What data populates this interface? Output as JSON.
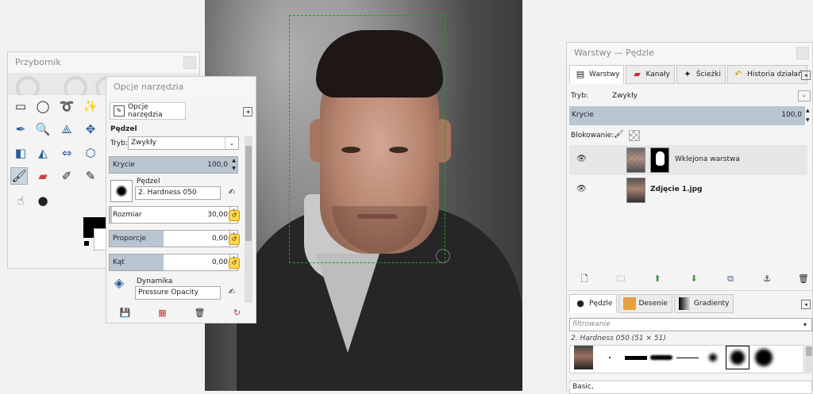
{
  "toolbox": {
    "title": "Przybornik",
    "tools": [
      "rect-select-icon",
      "ellipse-select-icon",
      "lasso-icon",
      "fuzzy-select-icon",
      "color-picker-icon",
      "zoom-icon",
      "measure-icon",
      "move-icon",
      "align-icon",
      "crop-icon",
      "transform-icon",
      "cage-icon",
      "paintbrush-icon",
      "eraser-icon",
      "airbrush-icon",
      "ink-icon",
      "smudge-icon",
      "dodge-burn-icon"
    ]
  },
  "tool_options": {
    "title": "Opcje narzędzia",
    "tab_label": "Opcje narzędzia",
    "heading": "Pędzel",
    "mode_label": "Tryb:",
    "mode_value": "Zwykły",
    "opacity_label": "Krycie",
    "opacity_value": "100,0",
    "opacity_fraction": 1.0,
    "brush_label": "Pędzel",
    "brush_value": "2. Hardness 050",
    "size_label": "Rozmiar",
    "size_value": "30,00",
    "aspect_label": "Proporcje",
    "aspect_value": "0,00",
    "angle_label": "Kąt",
    "angle_value": "0,00",
    "dynamics_label": "Dynamika",
    "dynamics_value": "Pressure Opacity"
  },
  "layers_dock": {
    "title": "Warstwy — Pędzle",
    "tabs": [
      "Warstwy",
      "Kanały",
      "Ścieżki",
      "Historia działań"
    ],
    "mode_label": "Tryb:",
    "mode_value": "Zwykły",
    "opacity_label": "Krycie",
    "opacity_value": "100,0",
    "lock_label": "Blokowanie:",
    "layers": [
      {
        "name": "Wklejona warstwa",
        "selected": true
      },
      {
        "name": "Zdjęcie 1.jpg",
        "selected": false
      }
    ]
  },
  "brushes_dock": {
    "tabs": [
      "Pędzle",
      "Desenie",
      "Gradienty"
    ],
    "filter_placeholder": "filtrowanie",
    "brush_info": "2. Hardness 050 (51 × 51)",
    "category_value": "Basic,"
  },
  "colors": {
    "selection": "#11aa11",
    "accent_bar": "#b9c6d1",
    "foreground": "#000000",
    "background": "#ffffff"
  }
}
